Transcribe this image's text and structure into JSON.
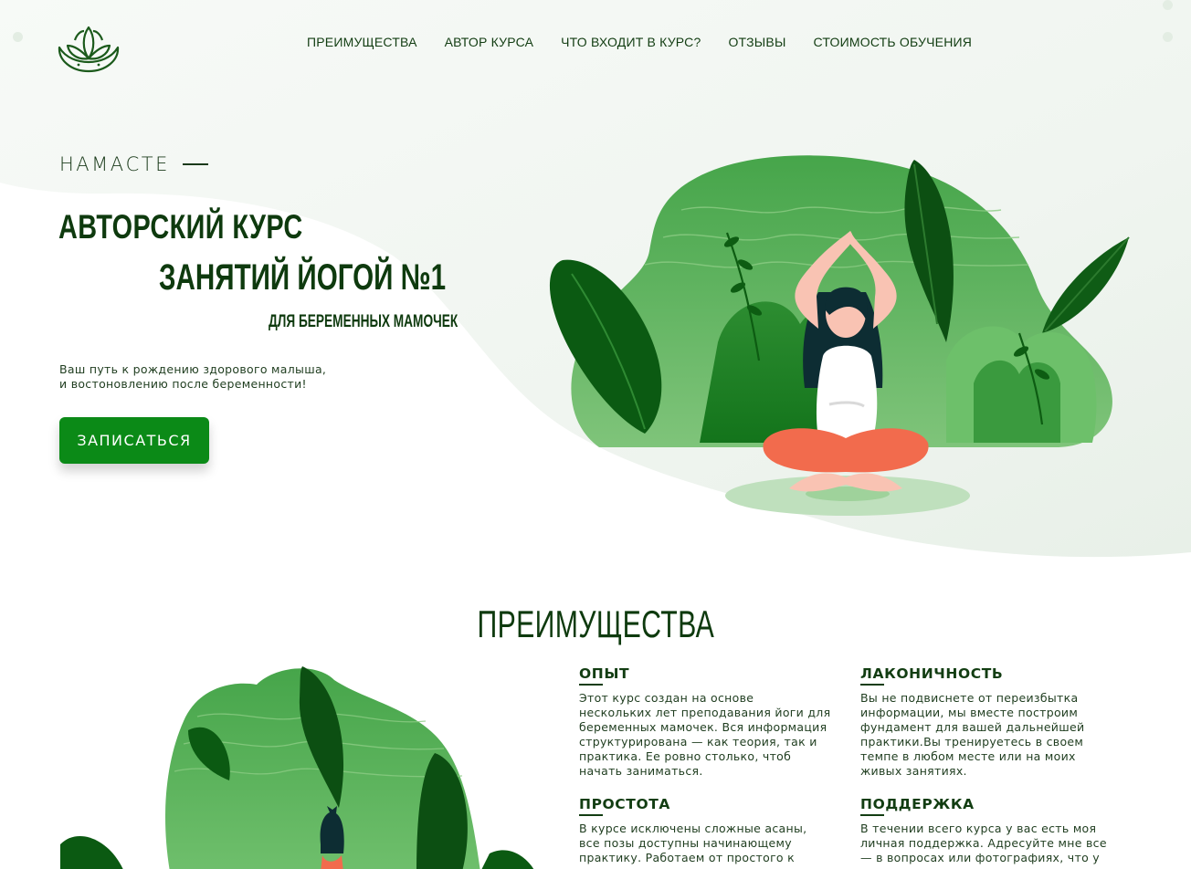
{
  "nav": {
    "items": [
      {
        "label": "ПРЕИМУЩЕСТВА"
      },
      {
        "label": "АВТОР КУРСА"
      },
      {
        "label": "ЧТО ВХОДИТ В КУРС?"
      },
      {
        "label": "ОТЗЫВЫ"
      },
      {
        "label": "СТОИМОСТЬ ОБУЧЕНИЯ"
      }
    ]
  },
  "icons": {
    "logo": "lotus-logo-icon"
  },
  "hero": {
    "eyebrow": "НАМАСТЕ",
    "title_line1": "АВТОРСКИЙ КУРС",
    "title_line2": "ЗАНЯТИЙ ЙОГОЙ №1",
    "title_line3": "ДЛЯ БЕРЕМЕННЫХ МАМОЧЕК",
    "description_line1": "Ваш путь к рождению здорового малыша,",
    "description_line2": "и востоновлению после беременности!",
    "cta_label": "ЗАПИСАТЬСЯ"
  },
  "advantages": {
    "title": "ПРЕИМУЩЕСТВА",
    "items": [
      {
        "heading": "ОПЫТ",
        "text": "Этот курс создан на основе\nнескольких лет преподавания йоги для\nбеременных мамочек. Вся информация\nструктурирована — как теория, так и\nпрактика. Ее ровно столько, чтоб\nначать заниматься."
      },
      {
        "heading": "ЛАКОНИЧНОСТЬ",
        "text": "Вы не подвиснете от переизбытка\nинформации, мы вместе построим\nфундамент для вашей дальнейшей\nпрактики.Вы тренируетесь в своем\nтемпе в любом месте или на моих\nживых занятиях."
      },
      {
        "heading": "ПРОСТОТА",
        "text": "В курсе исключены сложные асаны,\nвсе позы доступны начинающему\nпрактику. Работаем от простого к"
      },
      {
        "heading": "ПОДДЕРЖКА",
        "text": "В течении всего курса у вас есть моя\nличная поддержка. Адресуйте мне все\n— в вопросах или фотографиях, что у"
      }
    ]
  },
  "colors": {
    "accent": "#0b8a17",
    "dark_green": "#0e3a0e",
    "light_bg": "#eef4ee"
  }
}
